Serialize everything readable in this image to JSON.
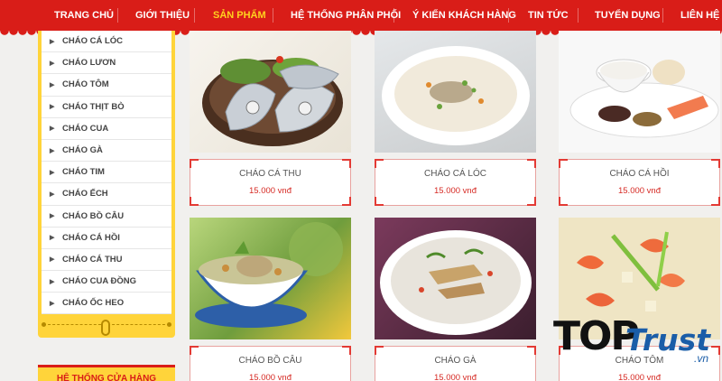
{
  "nav": {
    "items": [
      {
        "label": "TRANG CHỦ",
        "active": false
      },
      {
        "label": "GIỚI THIỆU",
        "active": false
      },
      {
        "label": "SẢN PHẨM",
        "active": true
      },
      {
        "label": "HỆ THỐNG PHÂN PHỐI",
        "active": false
      },
      {
        "label": "Ý KIẾN KHÁCH HÀNG",
        "active": false
      },
      {
        "label": "TIN TỨC",
        "active": false
      },
      {
        "label": "TUYỂN DỤNG",
        "active": false
      },
      {
        "label": "LIÊN HỆ",
        "active": false
      }
    ],
    "colors": {
      "background": "#d91d18",
      "text": "#ffffff",
      "active_text": "#ffd21f"
    }
  },
  "sidebar": {
    "items": [
      {
        "label": "CHÁO CÁ LÓC"
      },
      {
        "label": "CHÁO LƯƠN"
      },
      {
        "label": "CHÁO TÔM"
      },
      {
        "label": "CHÁO THỊT BÒ"
      },
      {
        "label": "CHÁO CUA"
      },
      {
        "label": "CHÁO GÀ"
      },
      {
        "label": "CHÁO TIM"
      },
      {
        "label": "CHÁO ẾCH"
      },
      {
        "label": "CHÁO BỒ CÂU"
      },
      {
        "label": "CHÁO CÁ HỒI"
      },
      {
        "label": "CHÁO CÁ THU"
      },
      {
        "label": "CHÁO CUA ĐỒNG"
      },
      {
        "label": "CHÁO ỐC HEO"
      }
    ],
    "arrow_icon": "triangle-right-icon",
    "store_heading": "HỆ THỐNG CỬA HÀNG",
    "accent": "#ffd43a"
  },
  "products": [
    {
      "name": "CHÁO CÁ THU",
      "price": "15.000 vnđ",
      "image": "sliced-fish-on-bowl"
    },
    {
      "name": "CHÁO CÁ LÓC",
      "price": "15.000 vnđ",
      "image": "fish-porridge-bowl"
    },
    {
      "name": "CHÁO CÁ HỒI",
      "price": "15.000 vnđ",
      "image": "salmon-porridge-plate"
    },
    {
      "name": "CHÁO BỒ CÂU",
      "price": "15.000 vnđ",
      "image": "pigeon-soup-blue-bowl"
    },
    {
      "name": "CHÁO GÀ",
      "price": "15.000 vnđ",
      "image": "chicken-porridge-bowl"
    },
    {
      "name": "CHÁO TÔM",
      "price": "15.000 vnđ",
      "image": "shrimp-porridge-closeup"
    }
  ],
  "price_color": "#d62a24",
  "watermark": {
    "brand_top": "TOP",
    "brand_trust": "Trust",
    "domain": ".vn",
    "color": "#1a5da8"
  }
}
